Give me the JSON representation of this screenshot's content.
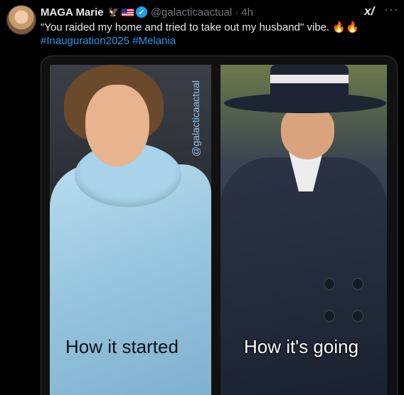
{
  "tweet": {
    "author_name": "MAGA Marie",
    "handle": "@galacticaactual",
    "separator": "·",
    "time": "4h",
    "badges": [
      "eagle-emoji",
      "us-flag-icon",
      "verified-badge-icon"
    ],
    "text": "\"You raided my home and tried to take out my husband\" vibe. 🔥🔥",
    "hashtags": [
      "#Inauguration2025",
      "#Melania"
    ],
    "grok_label": "x⃥",
    "more_label": "···"
  },
  "media": {
    "left_caption": "How it started",
    "right_caption": "How it's going",
    "watermark": "@galacticaactual"
  },
  "colors": {
    "background": "#000000",
    "link": "#1d9bf0",
    "muted": "#71767b",
    "text": "#e7e9ea"
  }
}
